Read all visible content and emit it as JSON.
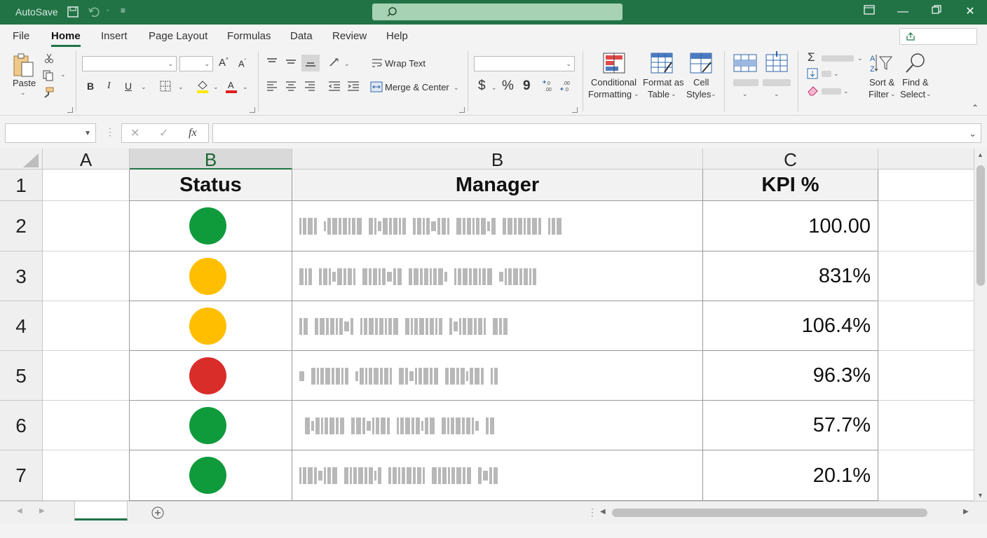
{
  "titlebar": {
    "autosave_label": "AutoSave",
    "search_placeholder": "",
    "bg_color": "#217346"
  },
  "menu": {
    "tabs": [
      "File",
      "Home",
      "Insert",
      "Page Layout",
      "Formulas",
      "Data",
      "Review",
      "Help"
    ],
    "active": "Home"
  },
  "ribbon": {
    "paste_label": "Paste",
    "wrap_text_label": "Wrap Text",
    "merge_center_label": "Merge & Center",
    "number_format_symbols": [
      "$",
      "%",
      "9"
    ],
    "conditional_formatting_line1": "Conditional",
    "conditional_formatting_line2": "Formatting",
    "format_table_line1": "Format as",
    "format_table_line2": "Table",
    "cell_styles_line1": "Cell",
    "cell_styles_line2": "Styles",
    "sort_filter_line1": "Sort &",
    "sort_filter_line2": "Filter",
    "find_select_line1": "Find &",
    "find_select_line2": "Select",
    "bold": "B",
    "italic": "I",
    "underline": "U"
  },
  "formula_bar": {
    "name_box": "",
    "fx_label": "fx",
    "formula": ""
  },
  "sheet": {
    "column_headers": [
      "A",
      "B",
      "B",
      "C"
    ],
    "selected_column": "B",
    "row_headers": [
      "1",
      "2",
      "3",
      "4",
      "5",
      "6",
      "7"
    ],
    "header_row": {
      "status": "Status",
      "manager": "Manager",
      "kpi": "KPI %"
    },
    "rows": [
      {
        "status_color": "#0f9b3c",
        "kpi": "100.00"
      },
      {
        "status_color": "#ffbf00",
        "kpi": "831%"
      },
      {
        "status_color": "#ffbf00",
        "kpi": "106.4%"
      },
      {
        "status_color": "#d92d2a",
        "kpi": "96.3%"
      },
      {
        "status_color": "#0f9b3c",
        "kpi": "57.7%"
      },
      {
        "status_color": "#0f9b3c",
        "kpi": "20.1%"
      }
    ]
  }
}
